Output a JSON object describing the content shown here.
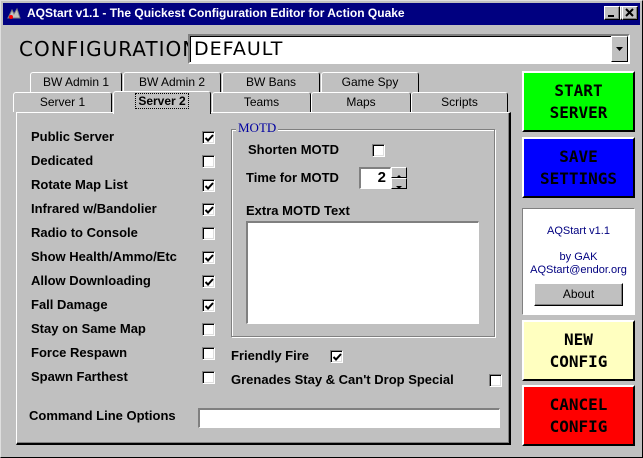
{
  "window": {
    "title": "AQStart v1.1 - The Quickest Configuration Editor for Action Quake"
  },
  "config": {
    "label": "CONFIGURATION",
    "selected": "DEFAULT"
  },
  "tabs_back": [
    "BW Admin 1",
    "BW Admin 2",
    "BW Bans",
    "Game Spy"
  ],
  "tabs_front": [
    "Server 1",
    "Server 2",
    "Teams",
    "Maps",
    "Scripts"
  ],
  "active_tab": "Server 2",
  "options": [
    {
      "label": "Public Server",
      "checked": true
    },
    {
      "label": "Dedicated",
      "checked": false
    },
    {
      "label": "Rotate Map List",
      "checked": true
    },
    {
      "label": "Infrared w/Bandolier",
      "checked": true
    },
    {
      "label": "Radio to Console",
      "checked": false
    },
    {
      "label": "Show Health/Ammo/Etc",
      "checked": true
    },
    {
      "label": "Allow Downloading",
      "checked": true
    },
    {
      "label": "Fall Damage",
      "checked": true
    },
    {
      "label": "Stay on Same Map",
      "checked": false
    },
    {
      "label": "Force Respawn",
      "checked": false
    },
    {
      "label": "Spawn Farthest",
      "checked": false
    }
  ],
  "motd": {
    "legend": "MOTD",
    "shorten_label": "Shorten MOTD",
    "shorten_checked": false,
    "time_label": "Time for MOTD",
    "time_value": "2",
    "extra_label": "Extra MOTD Text",
    "extra_value": ""
  },
  "friendly_fire": {
    "label": "Friendly Fire",
    "checked": true
  },
  "grenades": {
    "label": "Grenades Stay & Can't Drop Special",
    "checked": false
  },
  "command_line": {
    "label": "Command Line Options",
    "value": ""
  },
  "buttons": {
    "start": {
      "line1": "START",
      "line2": "SERVER",
      "bg": "#00ff00",
      "fg": "#000000"
    },
    "save": {
      "line1": "SAVE",
      "line2": "SETTINGS",
      "bg": "#0000ff",
      "fg": "#000000"
    },
    "new": {
      "line1": "NEW",
      "line2": "CONFIG",
      "bg": "#ffffc0",
      "fg": "#000000"
    },
    "cancel": {
      "line1": "CANCEL",
      "line2": "CONFIG",
      "bg": "#ff0000",
      "fg": "#000000"
    }
  },
  "info": {
    "version": "AQStart v1.1",
    "by": "by GAK",
    "email": "AQStart@endor.org",
    "about_label": "About"
  },
  "colors": {
    "titlebar": "#000080",
    "face": "#c0c0c0",
    "legend": "#0000a0",
    "info_text": "#000080"
  }
}
